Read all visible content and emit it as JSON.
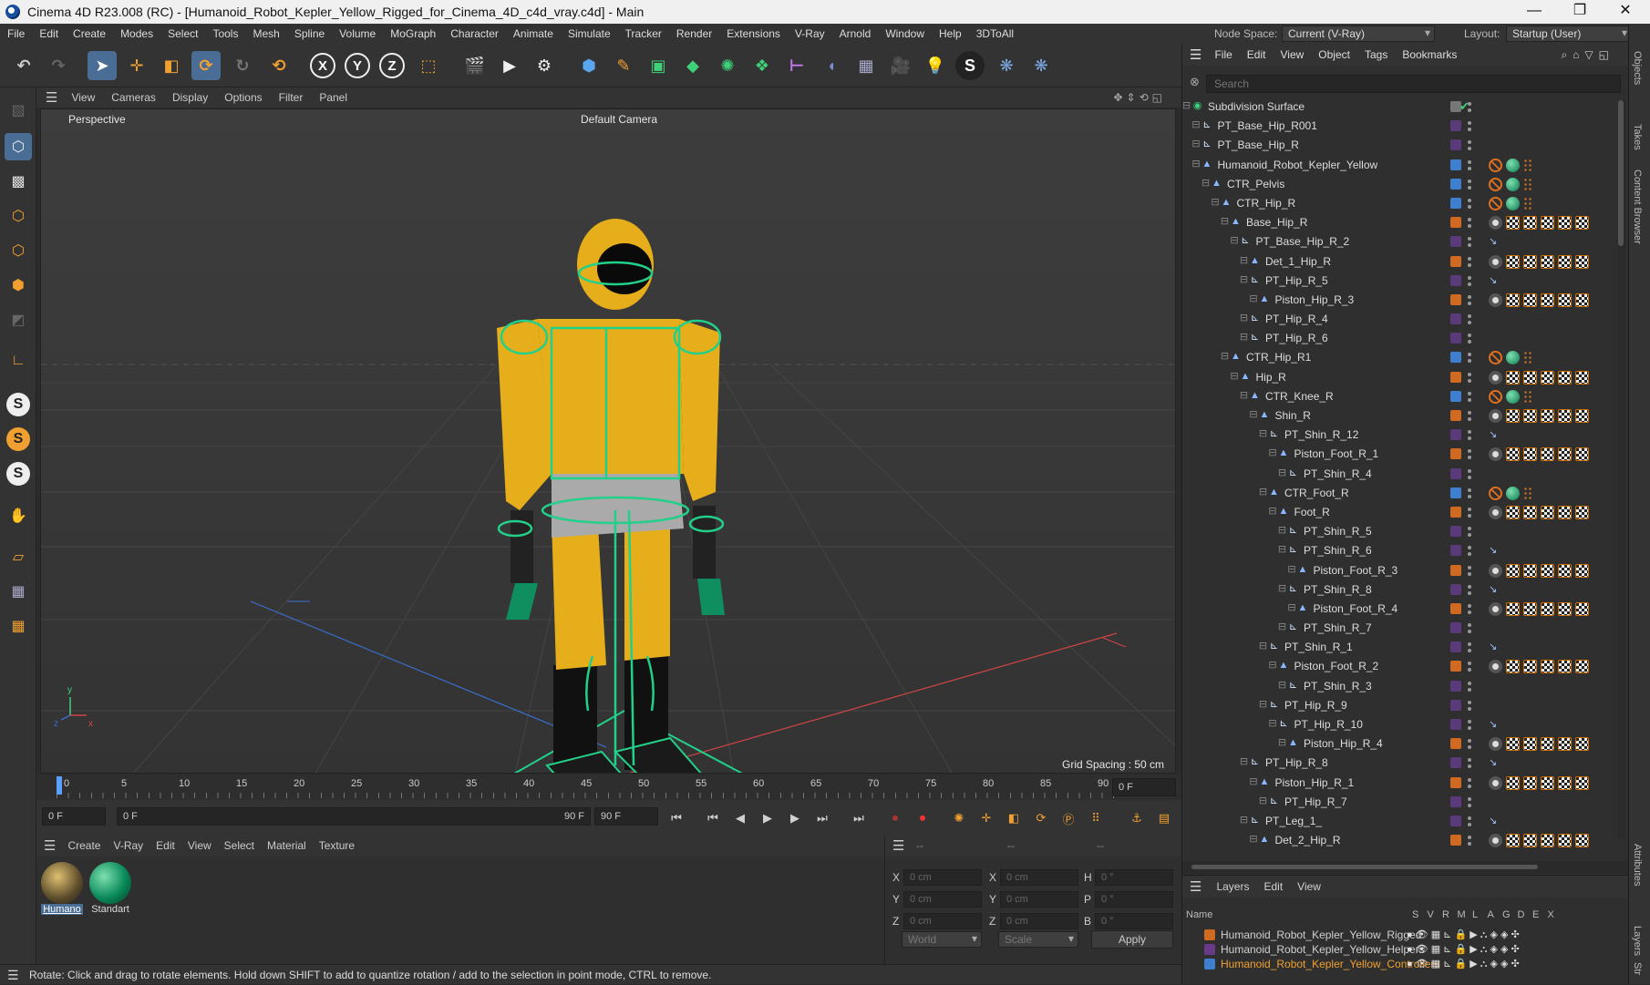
{
  "window": {
    "title": "Cinema 4D R23.008 (RC) - [Humanoid_Robot_Kepler_Yellow_Rigged_for_Cinema_4D_c4d_vray.c4d] - Main",
    "minimize": "—",
    "maximize": "❐",
    "close": "✕"
  },
  "menu": [
    "File",
    "Edit",
    "Create",
    "Modes",
    "Select",
    "Tools",
    "Mesh",
    "Spline",
    "Volume",
    "MoGraph",
    "Character",
    "Animate",
    "Simulate",
    "Tracker",
    "Render",
    "Extensions",
    "V-Ray",
    "Arnold",
    "Window",
    "Help",
    "3DToAll"
  ],
  "nodespace": {
    "label": "Node Space:",
    "value": "Current (V-Ray)",
    "layout_label": "Layout:",
    "layout_value": "Startup (User)"
  },
  "viewport": {
    "menu": [
      "View",
      "Cameras",
      "Display",
      "Options",
      "Filter",
      "Panel"
    ],
    "mode": "Perspective",
    "camera": "Default Camera",
    "grid": "Grid Spacing : 50 cm"
  },
  "timeline": {
    "ticks": [
      "0",
      "5",
      "10",
      "15",
      "20",
      "25",
      "30",
      "35",
      "40",
      "45",
      "50",
      "55",
      "60",
      "65",
      "70",
      "75",
      "80",
      "85",
      "90"
    ],
    "current": "0 F",
    "start": "0 F",
    "range_start": "0 F",
    "range_end": "90 F",
    "end": "90 F"
  },
  "materials": {
    "menu": [
      "Create",
      "V-Ray",
      "Edit",
      "View",
      "Select",
      "Material",
      "Texture"
    ],
    "items": [
      {
        "name": "Humano"
      },
      {
        "name": "Standart"
      }
    ]
  },
  "coords": {
    "header_left": "--",
    "header_mid": "--",
    "header_right": "--",
    "rows": [
      {
        "a": "X",
        "av": "0 cm",
        "b": "X",
        "bv": "0 cm",
        "c": "H",
        "cv": "0 °"
      },
      {
        "a": "Y",
        "av": "0 cm",
        "b": "Y",
        "bv": "0 cm",
        "c": "P",
        "cv": "0 °"
      },
      {
        "a": "Z",
        "av": "0 cm",
        "b": "Z",
        "bv": "0 cm",
        "c": "B",
        "cv": "0 °"
      }
    ],
    "world": "World",
    "scale": "Scale",
    "apply": "Apply"
  },
  "status": "Rotate: Click and drag to rotate elements. Hold down SHIFT to add to quantize rotation / add to the selection in point mode, CTRL to remove.",
  "objects": {
    "menu": [
      "File",
      "Edit",
      "View",
      "Object",
      "Tags",
      "Bookmarks"
    ],
    "search_placeholder": "Search",
    "rows": [
      {
        "name": "Subdivision Surface",
        "level": 0,
        "icon": "subdiv",
        "layer": "",
        "tags": "check"
      },
      {
        "name": "PT_Base_Hip_R001",
        "level": 1,
        "icon": "null",
        "layer": "#5a3a7a",
        "tags": ""
      },
      {
        "name": "PT_Base_Hip_R",
        "level": 1,
        "icon": "null",
        "layer": "#5a3a7a",
        "tags": ""
      },
      {
        "name": "Humanoid_Robot_Kepler_Yellow",
        "level": 1,
        "icon": "joint",
        "layer": "#3f7fd0",
        "tags": "ctrl"
      },
      {
        "name": "CTR_Pelvis",
        "level": 2,
        "icon": "joint",
        "layer": "#3f7fd0",
        "tags": "ctrl"
      },
      {
        "name": "CTR_Hip_R",
        "level": 3,
        "icon": "joint",
        "layer": "#3f7fd0",
        "tags": "ctrl"
      },
      {
        "name": "Base_Hip_R",
        "level": 4,
        "icon": "joint",
        "layer": "#d06a20",
        "tags": "geo"
      },
      {
        "name": "PT_Base_Hip_R_2",
        "level": 5,
        "icon": "null",
        "layer": "#5a3a7a",
        "tags": "ik"
      },
      {
        "name": "Det_1_Hip_R",
        "level": 6,
        "icon": "joint",
        "layer": "#d06a20",
        "tags": "geo"
      },
      {
        "name": "PT_Hip_R_5",
        "level": 6,
        "icon": "null",
        "layer": "#5a3a7a",
        "tags": "ik"
      },
      {
        "name": "Piston_Hip_R_3",
        "level": 7,
        "icon": "joint",
        "layer": "#d06a20",
        "tags": "geo"
      },
      {
        "name": "PT_Hip_R_4",
        "level": 6,
        "icon": "null",
        "layer": "#5a3a7a",
        "tags": ""
      },
      {
        "name": "PT_Hip_R_6",
        "level": 6,
        "icon": "null",
        "layer": "#5a3a7a",
        "tags": ""
      },
      {
        "name": "CTR_Hip_R1",
        "level": 4,
        "icon": "joint",
        "layer": "#3f7fd0",
        "tags": "ctrl"
      },
      {
        "name": "Hip_R",
        "level": 5,
        "icon": "joint",
        "layer": "#d06a20",
        "tags": "geo"
      },
      {
        "name": "CTR_Knee_R",
        "level": 6,
        "icon": "joint",
        "layer": "#3f7fd0",
        "tags": "ctrl"
      },
      {
        "name": "Shin_R",
        "level": 7,
        "icon": "joint",
        "layer": "#d06a20",
        "tags": "geo"
      },
      {
        "name": "PT_Shin_R_12",
        "level": 8,
        "icon": "null",
        "layer": "#5a3a7a",
        "tags": "ik"
      },
      {
        "name": "Piston_Foot_R_1",
        "level": 9,
        "icon": "joint",
        "layer": "#d06a20",
        "tags": "geo"
      },
      {
        "name": "PT_Shin_R_4",
        "level": 10,
        "icon": "null",
        "layer": "#5a3a7a",
        "tags": ""
      },
      {
        "name": "CTR_Foot_R",
        "level": 8,
        "icon": "joint",
        "layer": "#3f7fd0",
        "tags": "ctrl"
      },
      {
        "name": "Foot_R",
        "level": 9,
        "icon": "joint",
        "layer": "#d06a20",
        "tags": "geo"
      },
      {
        "name": "PT_Shin_R_5",
        "level": 10,
        "icon": "null",
        "layer": "#5a3a7a",
        "tags": ""
      },
      {
        "name": "PT_Shin_R_6",
        "level": 10,
        "icon": "null",
        "layer": "#5a3a7a",
        "tags": "ik"
      },
      {
        "name": "Piston_Foot_R_3",
        "level": 11,
        "icon": "joint",
        "layer": "#d06a20",
        "tags": "geo"
      },
      {
        "name": "PT_Shin_R_8",
        "level": 10,
        "icon": "null",
        "layer": "#5a3a7a",
        "tags": "ik"
      },
      {
        "name": "Piston_Foot_R_4",
        "level": 11,
        "icon": "joint",
        "layer": "#d06a20",
        "tags": "geo"
      },
      {
        "name": "PT_Shin_R_7",
        "level": 10,
        "icon": "null",
        "layer": "#5a3a7a",
        "tags": ""
      },
      {
        "name": "PT_Shin_R_1",
        "level": 8,
        "icon": "null",
        "layer": "#5a3a7a",
        "tags": "ik"
      },
      {
        "name": "Piston_Foot_R_2",
        "level": 9,
        "icon": "joint",
        "layer": "#d06a20",
        "tags": "geo"
      },
      {
        "name": "PT_Shin_R_3",
        "level": 10,
        "icon": "null",
        "layer": "#5a3a7a",
        "tags": ""
      },
      {
        "name": "PT_Hip_R_9",
        "level": 8,
        "icon": "null",
        "layer": "#5a3a7a",
        "tags": ""
      },
      {
        "name": "PT_Hip_R_10",
        "level": 9,
        "icon": "null",
        "layer": "#5a3a7a",
        "tags": "ik"
      },
      {
        "name": "Piston_Hip_R_4",
        "level": 10,
        "icon": "joint",
        "layer": "#d06a20",
        "tags": "geo"
      },
      {
        "name": "PT_Hip_R_8",
        "level": 6,
        "icon": "null",
        "layer": "#5a3a7a",
        "tags": "ik"
      },
      {
        "name": "Piston_Hip_R_1",
        "level": 7,
        "icon": "joint",
        "layer": "#d06a20",
        "tags": "geo"
      },
      {
        "name": "PT_Hip_R_7",
        "level": 8,
        "icon": "null",
        "layer": "#5a3a7a",
        "tags": ""
      },
      {
        "name": "PT_Leg_1_",
        "level": 6,
        "icon": "null",
        "layer": "#5a3a7a",
        "tags": "ik"
      },
      {
        "name": "Det_2_Hip_R",
        "level": 7,
        "icon": "joint",
        "layer": "#d06a20",
        "tags": "geo"
      }
    ]
  },
  "layers": {
    "menu": [
      "Layers",
      "Edit",
      "View"
    ],
    "name_header": "Name",
    "cols": [
      "S",
      "V",
      "R",
      "M",
      "L",
      "A",
      "G",
      "D",
      "E",
      "X"
    ],
    "items": [
      {
        "name": "Humanoid_Robot_Kepler_Yellow_Rigged",
        "color": "#d06a20"
      },
      {
        "name": "Humanoid_Robot_Kepler_Yellow_Helpers",
        "color": "#6a3a8a"
      },
      {
        "name": "Humanoid_Robot_Kepler_Yellow_Controllers",
        "color": "#3f7fd0"
      }
    ]
  },
  "sidestrip": [
    "Objects",
    "Takes",
    "Content Browser",
    "Attributes",
    "Layers",
    "Str"
  ]
}
